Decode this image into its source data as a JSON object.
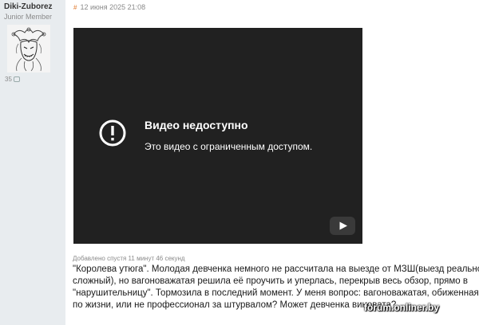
{
  "user": {
    "name": "Diki-Zuborez",
    "rank": "Junior Member",
    "post_count": "35"
  },
  "post": {
    "hash_icon": "#",
    "date": "12 июня 2025 21:08",
    "added_note": "Добавлено спустя 11 минут 46 секунд",
    "lines": [
      "\"Королева утюга\". Молодая девченка немного не рассчитала на выезде от МЗШ(выезд реально",
      "сложный), но вагоноважатая решила её проучить и уперлась, перекрыв весь обзор, прямо в",
      "\"нарушительницу\". Тормозила в последний момент. У меня вопрос: вагоноважатая, обиженная",
      "по жизни, или не профессионал за штурвалом? Может девченка виновата?"
    ]
  },
  "video": {
    "title": "Видео недоступно",
    "subtitle": "Это видео с ограниченным доступом.",
    "status_icon": "exclamation-circle-icon",
    "player_icon": "youtube-icon"
  },
  "watermark": "forum.onliner.by",
  "colors": {
    "sidebar_bg": "#e8ecef",
    "video_bg": "#212121",
    "meta_text": "#8a8a8a",
    "hash_accent": "#e07a2e"
  }
}
